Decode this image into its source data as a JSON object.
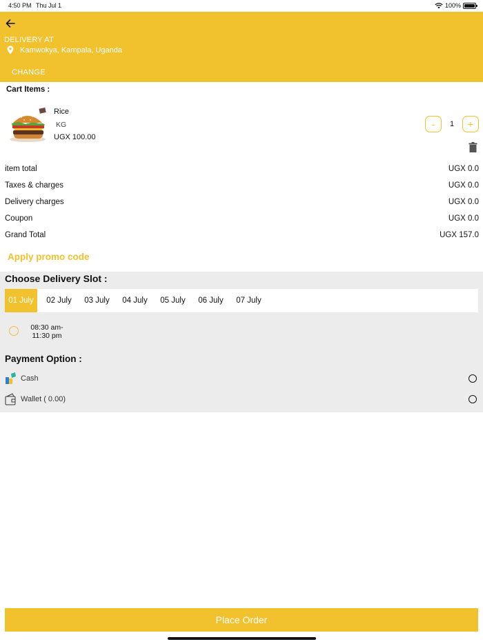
{
  "status_bar": {
    "time": "4:50 PM",
    "date": "Thu Jul 1",
    "battery": "100%"
  },
  "header": {
    "delivery_at_label": "DELIVERY AT",
    "location": "Kamwokya, Kampala, Uganda",
    "change_label": "CHANGE"
  },
  "cart": {
    "title": "Cart Items :",
    "items": [
      {
        "name": "Rice",
        "unit": "KG",
        "price": "UGX 100.00",
        "quantity": "1",
        "minus_label": "-",
        "plus_label": "+"
      }
    ]
  },
  "summary": [
    {
      "label": "item total",
      "value": "UGX 0.0"
    },
    {
      "label": "Taxes & charges",
      "value": "UGX 0.0"
    },
    {
      "label": "Delivery charges",
      "value": "UGX 0.0"
    },
    {
      "label": "Coupon",
      "value": "UGX 0.0"
    },
    {
      "label": "Grand Total",
      "value": "UGX 157.0"
    }
  ],
  "promo_label": "Apply promo code",
  "delivery_slot": {
    "title": "Choose Delivery Slot :",
    "dates": [
      "01 July",
      "02 July",
      "03 July",
      "04 July",
      "05 July",
      "06 July",
      "07 July"
    ],
    "selected_date": "01 July",
    "time_slot": "08:30 am-11:30 pm"
  },
  "payment": {
    "title": "Payment Option :",
    "options": [
      {
        "label": "Cash",
        "icon": "cash-icon"
      },
      {
        "label": "Wallet ( 0.00)",
        "icon": "wallet-icon"
      }
    ]
  },
  "place_order_label": "Place Order",
  "colors": {
    "accent": "#f2c12e",
    "section_bg": "#ececec"
  }
}
